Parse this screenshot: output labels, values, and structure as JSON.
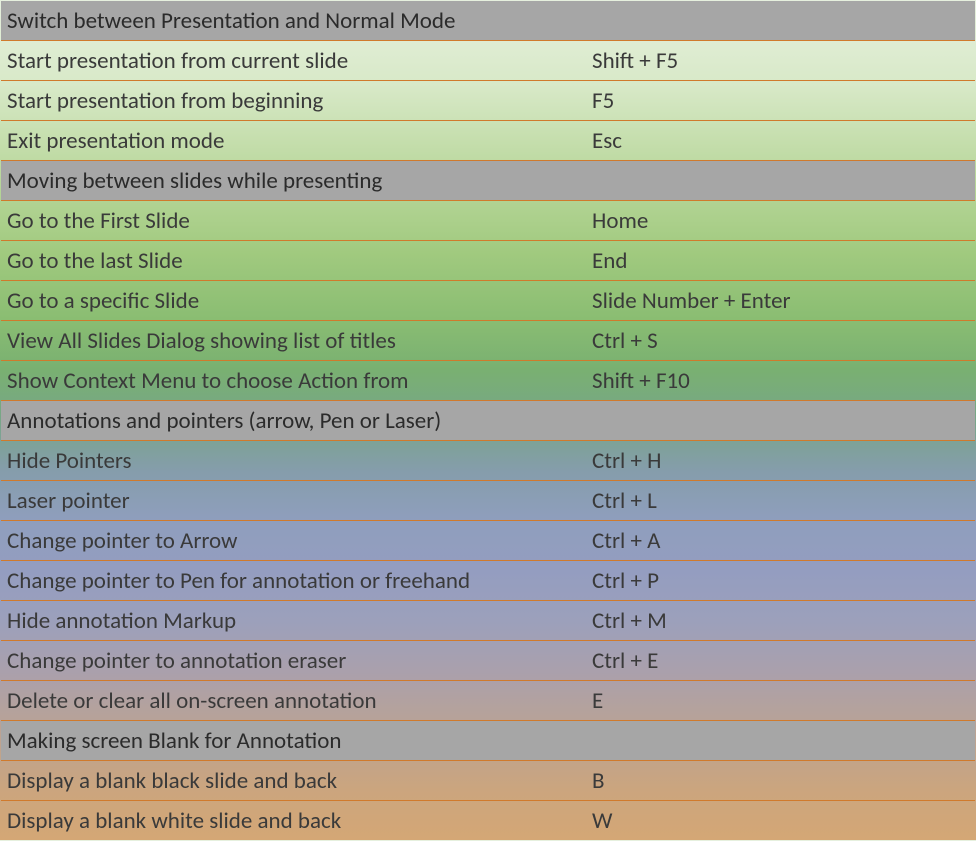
{
  "sections": [
    {
      "title": "Switch between Presentation and Normal Mode",
      "rows": [
        {
          "action": "Start presentation from current slide",
          "key": "Shift + F5"
        },
        {
          "action": "Start presentation from beginning",
          "key": "F5"
        },
        {
          "action": "Exit presentation mode",
          "key": "Esc"
        }
      ]
    },
    {
      "title": "Moving between slides while presenting",
      "rows": [
        {
          "action": "Go to the First Slide",
          "key": "Home"
        },
        {
          "action": "Go to the last Slide",
          "key": "End"
        },
        {
          "action": "Go to a specific Slide",
          "key": "Slide Number + Enter"
        },
        {
          "action": "View All Slides Dialog showing list of titles",
          "key": "Ctrl + S"
        },
        {
          "action": "Show Context Menu to choose Action from",
          "key": "Shift + F10"
        }
      ]
    },
    {
      "title": "Annotations and pointers (arrow, Pen or Laser)",
      "rows": [
        {
          "action": "Hide Pointers",
          "key": "Ctrl + H"
        },
        {
          "action": "Laser pointer",
          "key": "Ctrl + L"
        },
        {
          "action": "Change pointer to Arrow",
          "key": "Ctrl + A"
        },
        {
          "action": "Change pointer to Pen for annotation or freehand",
          "key": "Ctrl +  P"
        },
        {
          "action": "Hide annotation Markup",
          "key": "Ctrl + M"
        },
        {
          "action": "Change pointer to annotation eraser",
          "key": "Ctrl + E"
        },
        {
          "action": "Delete or clear all on-screen annotation",
          "key": "E"
        }
      ]
    },
    {
      "title": "Making screen Blank for Annotation",
      "rows": [
        {
          "action": "Display a blank black slide and back",
          "key": "B"
        },
        {
          "action": "Display a blank white slide and back",
          "key": "W"
        }
      ]
    }
  ]
}
